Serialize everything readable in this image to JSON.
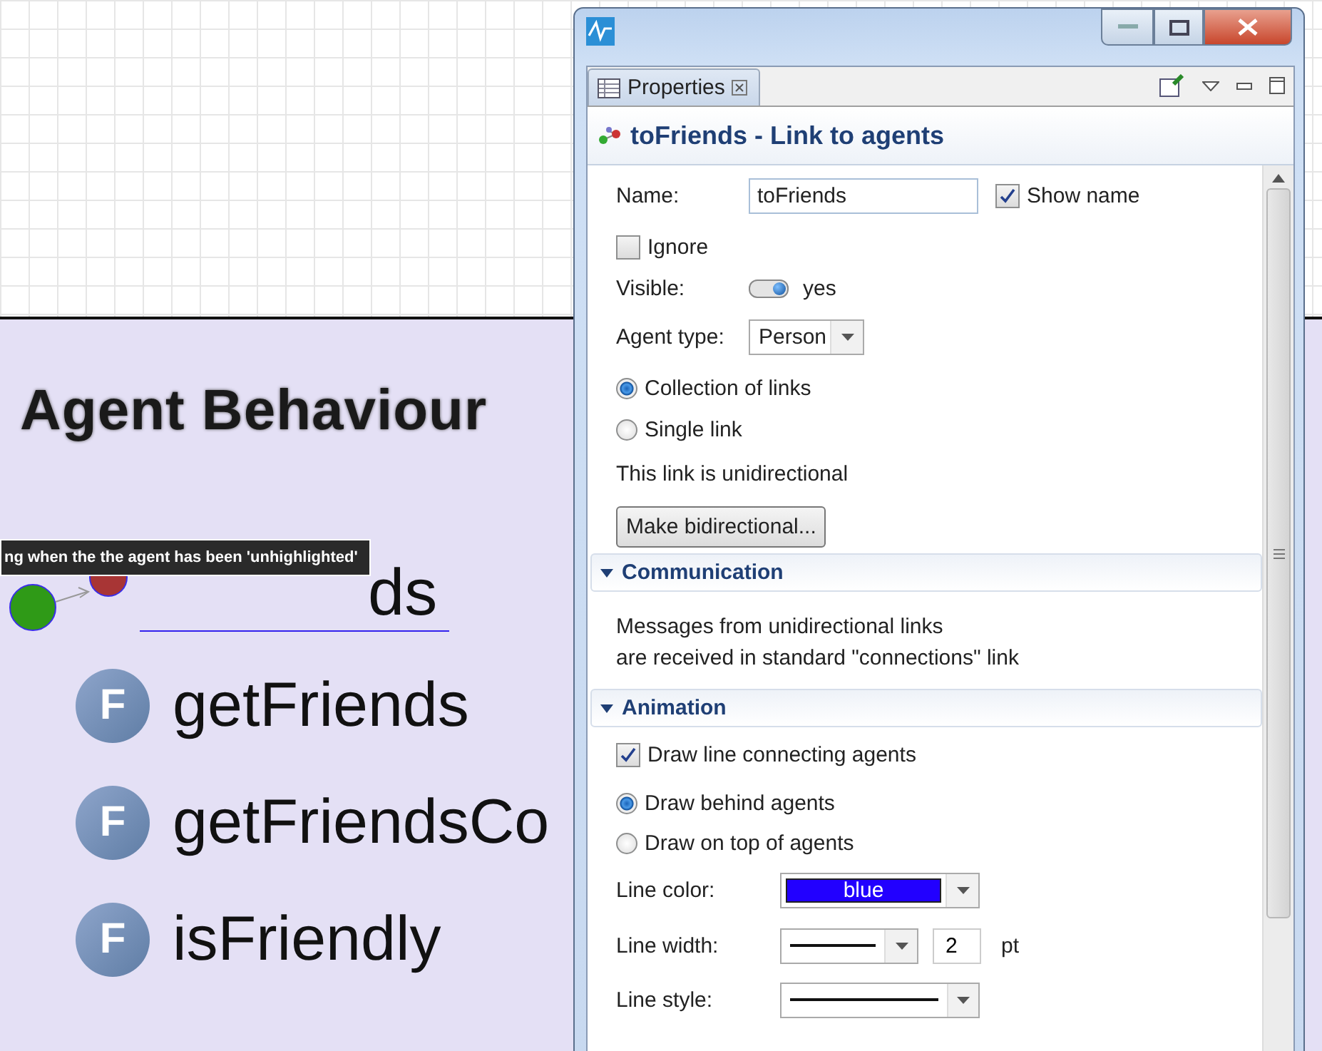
{
  "canvas": {
    "heading": "Agent Behaviour",
    "tooltip": "ng when the the agent has been 'unhighlighted'",
    "link": {
      "label": "ds"
    },
    "functions": [
      {
        "icon": "F",
        "name": "getFriends"
      },
      {
        "icon": "F",
        "name": "getFriendsCo"
      },
      {
        "icon": "F",
        "name": "isFriendly"
      }
    ]
  },
  "window": {
    "tab": {
      "label": "Properties",
      "selected": true
    }
  },
  "panel": {
    "title": "toFriends - Link to agents",
    "name": {
      "label": "Name:",
      "value": "toFriends"
    },
    "show_name": {
      "label": "Show name",
      "checked": true
    },
    "ignore": {
      "label": "Ignore",
      "checked": false
    },
    "visible": {
      "label": "Visible:",
      "on": true,
      "value": "yes"
    },
    "agent_type": {
      "label": "Agent type:",
      "value": "Person"
    },
    "link_mode": [
      {
        "label": "Collection of links",
        "selected": true
      },
      {
        "label": "Single link",
        "selected": false
      }
    ],
    "note": "This link is unidirectional",
    "button": "Make bidirectional...",
    "communication": {
      "title": "Communication",
      "expanded": true,
      "text": "Messages from unidirectional links\nare received in standard \"connections\" link"
    },
    "animation": {
      "title": "Animation",
      "expanded": true,
      "draw_line": {
        "label": "Draw line connecting agents",
        "checked": true
      },
      "draw_order": [
        {
          "label": "Draw behind agents",
          "selected": true
        },
        {
          "label": "Draw on top of agents",
          "selected": false
        }
      ],
      "line_color": {
        "label": "Line color:",
        "value": "blue",
        "color": "#2200ff"
      },
      "line_width": {
        "label": "Line width:",
        "value": "2",
        "unit": "pt"
      },
      "line_style": {
        "label": "Line style:"
      }
    }
  }
}
